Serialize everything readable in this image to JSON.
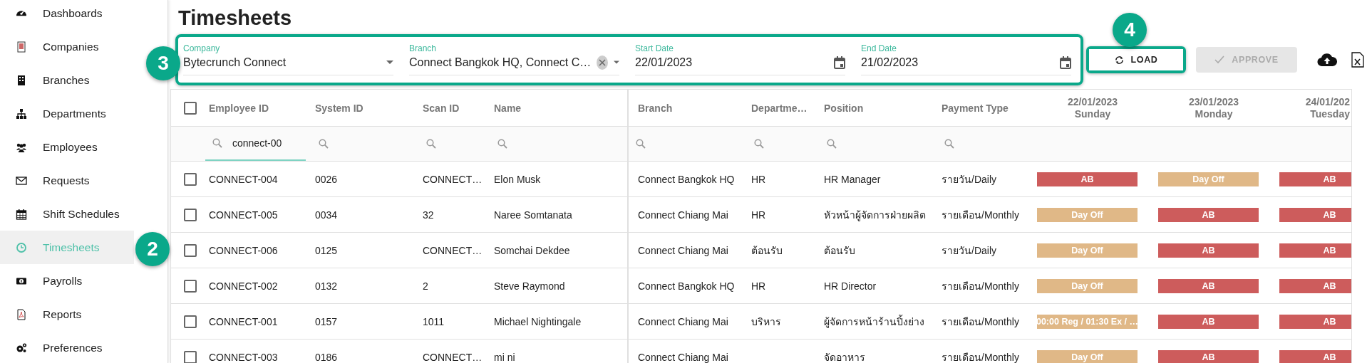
{
  "sidebar": {
    "items": [
      {
        "label": "Dashboards",
        "selected": false
      },
      {
        "label": "Companies",
        "selected": false
      },
      {
        "label": "Branches",
        "selected": false
      },
      {
        "label": "Departments",
        "selected": false
      },
      {
        "label": "Employees",
        "selected": false
      },
      {
        "label": "Requests",
        "selected": false
      },
      {
        "label": "Shift Schedules",
        "selected": false
      },
      {
        "label": "Timesheets",
        "selected": true
      },
      {
        "label": "Payrolls",
        "selected": false
      },
      {
        "label": "Reports",
        "selected": false
      },
      {
        "label": "Preferences",
        "selected": false
      }
    ]
  },
  "page_title": "Timesheets",
  "filters": [
    {
      "kind": "select",
      "label": "Company",
      "value": "Bytecrunch Connect"
    },
    {
      "kind": "multi_select",
      "label": "Branch",
      "value": "Connect Bangkok HQ, Connect C…"
    },
    {
      "kind": "date",
      "label": "Start Date",
      "value": "22/01/2023"
    },
    {
      "kind": "date",
      "label": "End Date",
      "value": "21/02/2023"
    }
  ],
  "actions": [
    {
      "kind": "load",
      "label": "LOAD",
      "disabled": false
    },
    {
      "kind": "approve",
      "label": "APPROVE",
      "disabled": true
    }
  ],
  "annotations": [
    {
      "label": "4"
    },
    {
      "label": "3"
    },
    {
      "label": "2"
    }
  ],
  "table": {
    "select_all_checked": false,
    "columns": [
      {
        "label": "Employee ID",
        "filterable": true,
        "filter_value": "connect-00"
      },
      {
        "label": "System ID",
        "filterable": true
      },
      {
        "label": "Scan ID",
        "filterable": true
      },
      {
        "label": "Name",
        "filterable": true
      },
      {
        "label": "Branch",
        "filterable": true
      },
      {
        "label": "Departme…",
        "filterable": true
      },
      {
        "label": "Position",
        "filterable": true
      },
      {
        "label": "Payment Type",
        "filterable": true
      }
    ],
    "days": [
      {
        "date": "22/01/2023",
        "weekday": "Sunday"
      },
      {
        "date": "23/01/2023",
        "weekday": "Monday"
      },
      {
        "date": "24/01/202",
        "weekday": "Tuesday"
      }
    ],
    "rows": [
      {
        "checked": false,
        "cells": [
          "CONNECT-004",
          "0026",
          "CONNECT…",
          "Elon Musk",
          "Connect Bangkok HQ",
          "HR",
          "HR Manager",
          "รายวัน/Daily"
        ],
        "days": [
          {
            "kind": "absent",
            "text": "AB"
          },
          {
            "kind": "day_off",
            "text": "Day Off"
          },
          {
            "kind": "absent",
            "text": "AB"
          }
        ]
      },
      {
        "checked": false,
        "cells": [
          "CONNECT-005",
          "0034",
          "32",
          "Naree Somtanata",
          "Connect Chiang Mai",
          "HR",
          "หัวหน้าผู้จัดการฝ่ายผลิต",
          "รายเดือน/Monthly"
        ],
        "days": [
          {
            "kind": "day_off",
            "text": "Day Off"
          },
          {
            "kind": "absent",
            "text": "AB"
          },
          {
            "kind": "absent",
            "text": "AB"
          }
        ]
      },
      {
        "checked": false,
        "cells": [
          "CONNECT-006",
          "0125",
          "CONNECT…",
          "Somchai Dekdee",
          "Connect Chiang Mai",
          "ต้อนรับ",
          "ต้อนรับ",
          "รายวัน/Daily"
        ],
        "days": [
          {
            "kind": "day_off",
            "text": "Day Off"
          },
          {
            "kind": "absent",
            "text": "AB"
          },
          {
            "kind": "absent",
            "text": "AB"
          }
        ]
      },
      {
        "checked": false,
        "cells": [
          "CONNECT-002",
          "0132",
          "2",
          "Steve Raymond",
          "Connect Bangkok HQ",
          "HR",
          "HR Director",
          "รายเดือน/Monthly"
        ],
        "days": [
          {
            "kind": "day_off",
            "text": "Day Off"
          },
          {
            "kind": "absent",
            "text": "AB"
          },
          {
            "kind": "absent",
            "text": "AB"
          }
        ]
      },
      {
        "checked": false,
        "cells": [
          "CONNECT-001",
          "0157",
          "1011",
          "Michael Nightingale",
          "Connect Chiang Mai",
          "บริหาร",
          "ผู้จัดการหน้าร้านปิ้งย่าง",
          "รายเดือน/Monthly"
        ],
        "days": [
          {
            "kind": "day_off",
            "text": "00:00 Reg / 01:30 Ex / …"
          },
          {
            "kind": "absent",
            "text": "AB"
          },
          {
            "kind": "absent",
            "text": "AB"
          }
        ]
      },
      {
        "checked": false,
        "cells": [
          "CONNECT-003",
          "0186",
          "CONNECT…",
          "mi ni",
          "Connect Chiang Mai",
          null,
          "จัดอาหาร",
          "รายเดือน/Monthly"
        ],
        "days": [
          {
            "kind": "day_off",
            "text": "Day Off"
          },
          {
            "kind": "absent",
            "text": "AB"
          },
          {
            "kind": "absent",
            "text": "AB"
          }
        ]
      }
    ]
  }
}
